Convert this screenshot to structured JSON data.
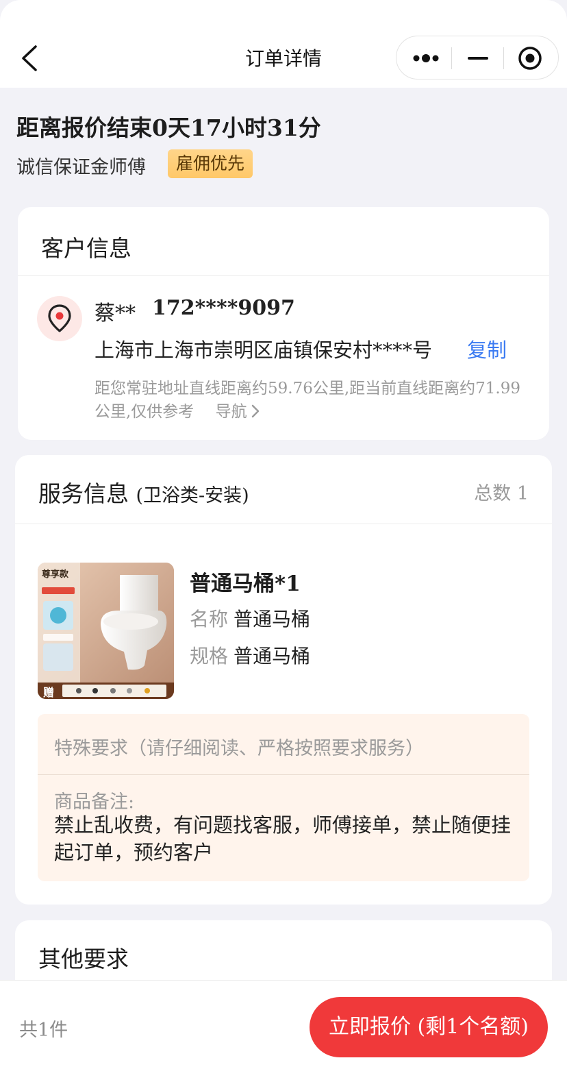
{
  "nav": {
    "title": "订单详情"
  },
  "header": {
    "countdown": "距离报价结束0天17小时31分",
    "guarantee": "诚信保证金师傅",
    "badge": "雇佣优先"
  },
  "customer": {
    "section_title": "客户信息",
    "name": "蔡**",
    "phone": "172****9097",
    "address": "上海市上海市崇明区庙镇保安村****号",
    "copy": "复制",
    "distance": "距您常驻地址直线距离约59.76公里,距当前直线距离约71.99公里,仅供参考",
    "navigate": "导航"
  },
  "service": {
    "title": "服务信息",
    "subtitle": "(卫浴类-安装)",
    "total": "总数 1",
    "product": {
      "name": "普通马桶*1",
      "name_label": "名称",
      "name_value": "普通马桶",
      "spec_label": "规格",
      "spec_value": "普通马桶",
      "thumb_tag": "尊享款",
      "thumb_gift": "赠"
    },
    "special": {
      "heading": "特殊要求（请仔细阅读、严格按照要求服务）",
      "note_label": "商品备注:",
      "note_text": "禁止乱收费，有问题找客服，师傅接单，禁止随便挂起订单，预约客户"
    }
  },
  "other": {
    "title": "其他要求"
  },
  "footer": {
    "count": "共1件",
    "button": "立即报价 (剩1个名额)"
  },
  "colors": {
    "accent_red": "#f0393a",
    "link_blue": "#3a7af2",
    "badge_gold": "#ffc868"
  }
}
